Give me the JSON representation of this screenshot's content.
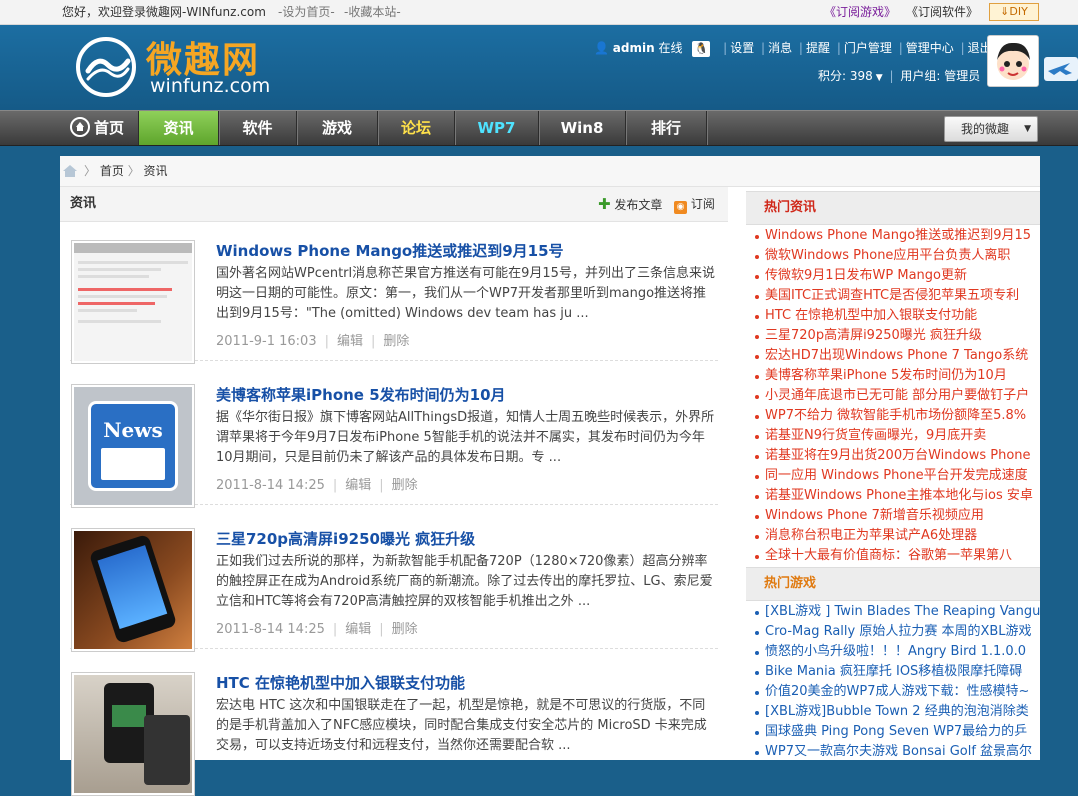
{
  "topbar": {
    "welcome": "您好，欢迎登录微趣网-WINfunz.com",
    "set_home": "-设为首页-",
    "add_fav": "-收藏本站-",
    "subscribe_games": "《订阅游戏》",
    "subscribe_software": "《订阅软件》",
    "diy": "DIY"
  },
  "logo": {
    "cn": "微趣网",
    "en": "winfunz.com"
  },
  "user": {
    "name": "admin",
    "status": "在线",
    "links": [
      "设置",
      "消息",
      "提醒",
      "门户管理",
      "管理中心",
      "退出"
    ],
    "points_label": "积分: 398",
    "group_label": "用户组: 管理员"
  },
  "nav": {
    "items": [
      {
        "label": "首页"
      },
      {
        "label": "资讯",
        "active": true
      },
      {
        "label": "软件"
      },
      {
        "label": "游戏"
      },
      {
        "label": "论坛",
        "color": "#ffe14a"
      },
      {
        "label": "WP7",
        "color": "#4fe3ff"
      },
      {
        "label": "Win8"
      },
      {
        "label": "排行"
      }
    ],
    "my_space": "我的微趣"
  },
  "breadcrumb": {
    "home": "首页",
    "current": "资讯"
  },
  "section": {
    "title": "资讯",
    "post": "发布文章",
    "subscribe": "订阅"
  },
  "articles": [
    {
      "title": "Windows Phone Mango推送或推迟到9月15号",
      "summary": "国外著名网站WPcentrl消息称芒果官方推送有可能在9月15号，并列出了三条信息来说明这一日期的可能性。原文：第一，我们从一个WP7开发者那里听到mango推送将推出到9月15号：\"The (omitted) Windows dev team has ju ...",
      "date": "2011-9-1 16:03",
      "edit": "编辑",
      "delete": "删除"
    },
    {
      "title": "美博客称苹果iPhone 5发布时间仍为10月",
      "summary": "据《华尔街日报》旗下博客网站AllThingsD报道，知情人士周五晚些时候表示，外界所谓苹果将于今年9月7日发布iPhone 5智能手机的说法并不属实，其发布时间仍为今年10月期间，只是目前仍未了解该产品的具体发布日期。专 ...",
      "date": "2011-8-14 14:25",
      "edit": "编辑",
      "delete": "删除",
      "thumb_text": "News"
    },
    {
      "title": "三星720p高清屏i9250曝光 疯狂升级",
      "summary": "正如我们过去所说的那样，为新款智能手机配备720P（1280×720像素）超高分辨率的触控屏正在成为Android系统厂商的新潮流。除了过去传出的摩托罗拉、LG、索尼爱立信和HTC等将会有720P高清触控屏的双核智能手机推出之外 ...",
      "date": "2011-8-14 14:25",
      "edit": "编辑",
      "delete": "删除"
    },
    {
      "title": "HTC 在惊艳机型中加入银联支付功能",
      "summary": "宏达电 HTC 这次和中国银联走在了一起，机型是惊艳，就是不可思议的行货版，不同的是手机背盖加入了NFC感应模块，同时配合集成支付安全芯片的 MicroSD 卡来完成交易，可以支持近场支付和远程支付，当然你还需要配合软 ...",
      "date": "",
      "edit": "",
      "delete": ""
    }
  ],
  "hot_news": {
    "title": "热门资讯",
    "items": [
      "Windows Phone Mango推送或推迟到9月15",
      "微软Windows Phone应用平台负责人离职",
      "传微软9月1日发布WP Mango更新",
      "美国ITC正式调查HTC是否侵犯苹果五项专利",
      "HTC 在惊艳机型中加入银联支付功能",
      "三星720p高清屏i9250曝光 疯狂升级",
      "宏达HD7出现Windows Phone 7 Tango系统",
      "美博客称苹果iPhone 5发布时间仍为10月",
      "小灵通年底退市已无可能 部分用户要做钉子户",
      "WP7不给力 微软智能手机市场份额降至5.8%",
      "诺基亚N9行货宣传画曝光，9月底开卖",
      "诺基亚将在9月出货200万台Windows Phone",
      "同一应用 Windows Phone平台开发完成速度",
      "诺基亚Windows Phone主推本地化与ios 安卓",
      "Windows Phone 7新增音乐视频应用",
      "消息称台积电正为苹果试产A6处理器",
      "全球十大最有价值商标：谷歌第一苹果第八"
    ]
  },
  "hot_games": {
    "title": "热门游戏",
    "items": [
      "[XBL游戏 ] Twin Blades The Reaping Vangu",
      "Cro-Mag Rally 原始人拉力赛 本周的XBL游戏",
      "愤怒的小鸟升级啦！！！Angry Bird 1.1.0.0",
      "Bike Mania 疯狂摩托 IOS移植极限摩托障碍",
      "价值20美金的WP7成人游戏下载：性感模特~",
      "[XBL游戏]Bubble Town 2 经典的泡泡消除类",
      "国球盛典 Ping Pong Seven WP7最给力的乒",
      "WP7又一款高尔夫游戏 Bonsai Golf 盆景高尔"
    ]
  },
  "colors": {
    "brand_blue": "#1a5f8a",
    "active_green": "#6cb33e",
    "hot_red": "#e03820",
    "link_blue": "#1750a6",
    "games_orange": "#e07a10"
  }
}
